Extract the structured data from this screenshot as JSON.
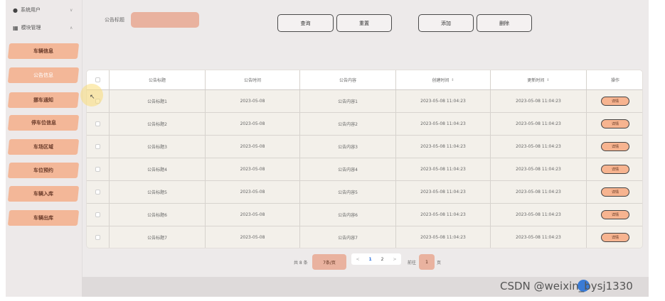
{
  "sidebar": {
    "groups": [
      {
        "label": "系统用户",
        "icon": "user-icon"
      },
      {
        "label": "模块管理",
        "icon": "grid-icon"
      }
    ],
    "items": [
      {
        "label": "车辆信息"
      },
      {
        "label": "公告信息"
      },
      {
        "label": "挪车通知"
      },
      {
        "label": "停车位信息"
      },
      {
        "label": "车场区域"
      },
      {
        "label": "车位预约"
      },
      {
        "label": "车辆入库"
      },
      {
        "label": "车辆出库"
      }
    ]
  },
  "filter": {
    "label": "公告标题",
    "value": "",
    "placeholder": ""
  },
  "toolbar": {
    "query_label": "查询",
    "reset_label": "重置",
    "add_label": "添加",
    "delete_label": "删除"
  },
  "table": {
    "headers": {
      "title": "公告标题",
      "time": "公告时间",
      "content": "公告内容",
      "created": "创建时间",
      "updated": "更新时间",
      "action": "操作"
    },
    "detail_label": "详情",
    "rows": [
      {
        "title": "公告标题1",
        "time": "2023-05-08",
        "content": "公告内容1",
        "created": "2023-05-08 11:04:23",
        "updated": "2023-05-08 11:04:23"
      },
      {
        "title": "公告标题2",
        "time": "2023-05-08",
        "content": "公告内容2",
        "created": "2023-05-08 11:04:23",
        "updated": "2023-05-08 11:04:23"
      },
      {
        "title": "公告标题3",
        "time": "2023-05-08",
        "content": "公告内容3",
        "created": "2023-05-08 11:04:23",
        "updated": "2023-05-08 11:04:23"
      },
      {
        "title": "公告标题4",
        "time": "2023-05-08",
        "content": "公告内容4",
        "created": "2023-05-08 11:04:23",
        "updated": "2023-05-08 11:04:23"
      },
      {
        "title": "公告标题5",
        "time": "2023-05-08",
        "content": "公告内容5",
        "created": "2023-05-08 11:04:23",
        "updated": "2023-05-08 11:04:23"
      },
      {
        "title": "公告标题6",
        "time": "2023-05-08",
        "content": "公告内容6",
        "created": "2023-05-08 11:04:23",
        "updated": "2023-05-08 11:04:23"
      },
      {
        "title": "公告标题7",
        "time": "2023-05-08",
        "content": "公告内容7",
        "created": "2023-05-08 11:04:23",
        "updated": "2023-05-08 11:04:23"
      }
    ]
  },
  "pagination": {
    "total_text": "共 8 条",
    "page_size": "7条/页",
    "prev": "<",
    "pages": [
      "1",
      "2"
    ],
    "current_page": "1",
    "next": ">",
    "goto_prefix": "前往",
    "goto_value": "1",
    "goto_suffix": "页"
  },
  "watermark": {
    "text": "CSDN @weixin_bysj1330"
  },
  "colors": {
    "accent": "#f3b798",
    "input_bg": "#e9b29f",
    "page_bg": "#edeaea"
  }
}
